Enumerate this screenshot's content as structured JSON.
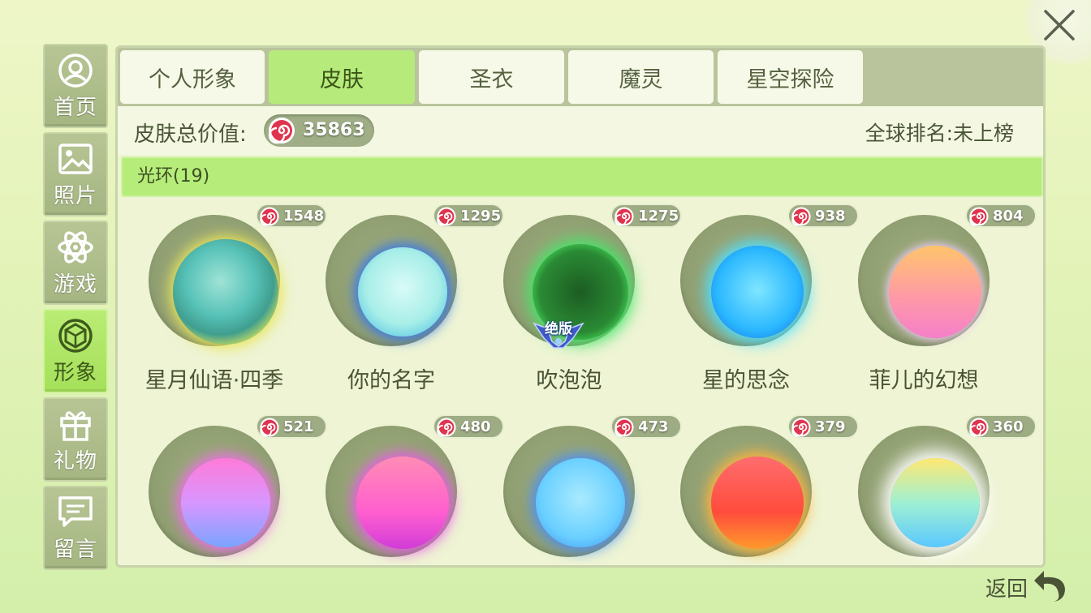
{
  "window": {
    "close_icon": "close-x-icon"
  },
  "sidebar": {
    "items": [
      {
        "label": "首页",
        "icon": "user-circle-icon",
        "active": false
      },
      {
        "label": "照片",
        "icon": "picture-icon",
        "active": false
      },
      {
        "label": "游戏",
        "icon": "atom-icon",
        "active": false
      },
      {
        "label": "形象",
        "icon": "diamond-icon",
        "active": true
      },
      {
        "label": "礼物",
        "icon": "gift-icon",
        "active": false
      },
      {
        "label": "留言",
        "icon": "message-icon",
        "active": false
      }
    ]
  },
  "tabs": [
    {
      "label": "个人形象",
      "active": false
    },
    {
      "label": "皮肤",
      "active": true
    },
    {
      "label": "圣衣",
      "active": false
    },
    {
      "label": "魔灵",
      "active": false
    },
    {
      "label": "星空探险",
      "active": false
    }
  ],
  "summary": {
    "title": "皮肤总价值:",
    "total_value": "35863",
    "rank_text": "全球排名:未上榜"
  },
  "category": {
    "label": "光环(19)"
  },
  "items": [
    {
      "name": "星月仙语·四季",
      "price": "1548",
      "badge": ""
    },
    {
      "name": "你的名字",
      "price": "1295",
      "badge": ""
    },
    {
      "name": "吹泡泡",
      "price": "1275",
      "badge": "绝版"
    },
    {
      "name": "星的思念",
      "price": "938",
      "badge": ""
    },
    {
      "name": "菲儿的幻想",
      "price": "804",
      "badge": ""
    },
    {
      "name": "",
      "price": "521",
      "badge": ""
    },
    {
      "name": "",
      "price": "480",
      "badge": ""
    },
    {
      "name": "",
      "price": "473",
      "badge": ""
    },
    {
      "name": "",
      "price": "379",
      "badge": ""
    },
    {
      "name": "",
      "price": "360",
      "badge": ""
    }
  ],
  "footer": {
    "back_label": "返回",
    "back_icon": "return-arrow-icon"
  },
  "colors": {
    "accent_green": "#b6ea7a",
    "sidebar_gray": "#a5b682",
    "candy_red": "#e0344e"
  }
}
